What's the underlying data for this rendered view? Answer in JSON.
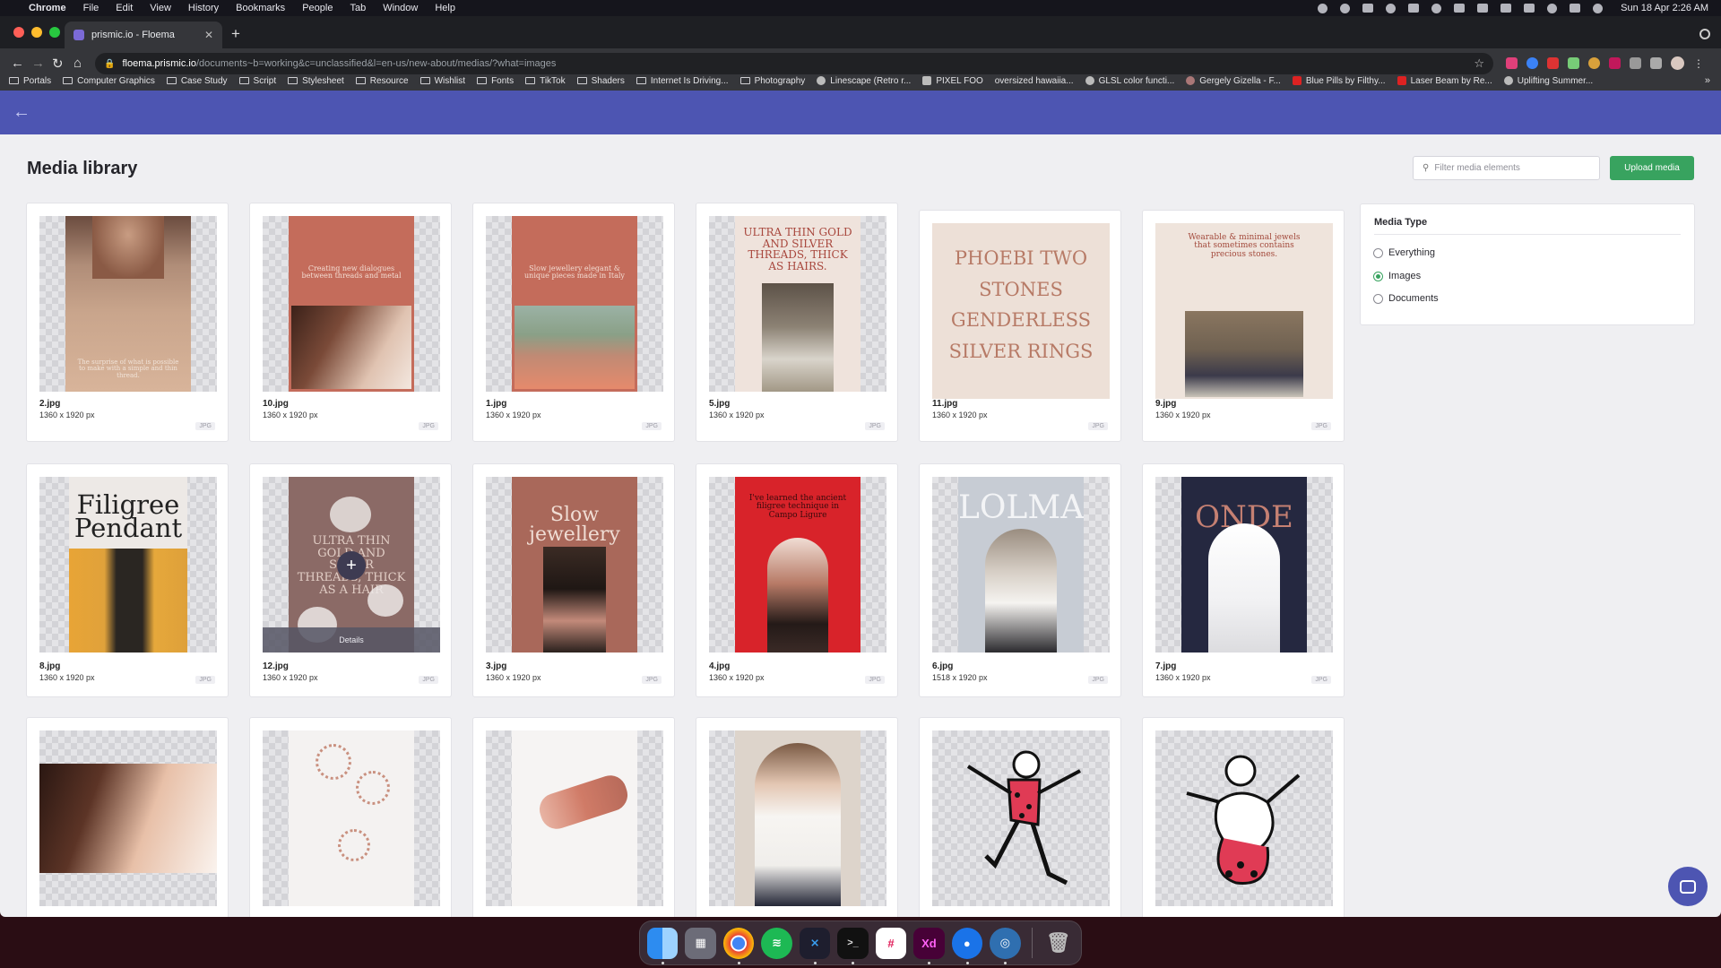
{
  "menubar": {
    "app": "Chrome",
    "items": [
      "File",
      "Edit",
      "View",
      "History",
      "Bookmarks",
      "People",
      "Tab",
      "Window",
      "Help"
    ],
    "clock": "Sun 18 Apr  2:26 AM"
  },
  "browser": {
    "tab_title": "prismic.io - Floema",
    "url_host": "floema.prismic.io",
    "url_path": "/documents~b=working&c=unclassified&l=en-us/new-about/medias/?what=images",
    "bookmarks": [
      "Portals",
      "Computer Graphics",
      "Case Study",
      "Script",
      "Stylesheet",
      "Resource",
      "Wishlist",
      "Fonts",
      "TikTok",
      "Shaders",
      "Internet Is Driving...",
      "Photography",
      "Linescape (Retro r...",
      "PIXEL FOO",
      "oversized hawaiia...",
      "GLSL color functi...",
      "Gergely Gizella - F...",
      "Blue Pills by Filthy...",
      "Laser Beam by Re...",
      "Uplifting Summer..."
    ]
  },
  "page": {
    "title": "Media library",
    "filter_placeholder": "Filter media elements",
    "upload_label": "Upload media"
  },
  "media_type": {
    "title": "Media Type",
    "options": [
      "Everything",
      "Images",
      "Documents"
    ],
    "selected": "Images"
  },
  "media": [
    {
      "name": "2.jpg",
      "size": "1360 x 1920 px",
      "type": "JPG",
      "poster_text": "The surprise of what is possible to make with a simple and thin thread."
    },
    {
      "name": "10.jpg",
      "size": "1360 x 1920 px",
      "type": "JPG",
      "poster_text": "Creating new dialogues between threads and metal"
    },
    {
      "name": "1.jpg",
      "size": "1360 x 1920 px",
      "type": "JPG",
      "poster_text": "Slow jewellery elegant & unique pieces made in Italy"
    },
    {
      "name": "5.jpg",
      "size": "1360 x 1920 px",
      "type": "JPG",
      "poster_text": "ULTRA THIN GOLD AND SILVER THREADS, THICK AS HAIRS."
    },
    {
      "name": "11.jpg",
      "size": "1360 x 1920 px",
      "type": "JPG",
      "poster_text": "PHOEBI TWO STONES GENDERLESS SILVER RINGS"
    },
    {
      "name": "9.jpg",
      "size": "1360 x 1920 px",
      "type": "JPG",
      "poster_text": "Wearable & minimal jewels that sometimes contains precious stones."
    },
    {
      "name": "8.jpg",
      "size": "1360 x 1920 px",
      "type": "JPG",
      "poster_text": "Filigree Pendant"
    },
    {
      "name": "12.jpg",
      "size": "1360 x 1920 px",
      "type": "JPG",
      "poster_text": "ULTRA THIN GOLD AND SILVER THREADS, THICK AS A HAIR",
      "overlay_details": "Details"
    },
    {
      "name": "3.jpg",
      "size": "1360 x 1920 px",
      "type": "JPG",
      "poster_text": "Slow jewellery"
    },
    {
      "name": "4.jpg",
      "size": "1360 x 1920 px",
      "type": "JPG",
      "poster_text": "I've learned the ancient filigree technique in Campo Ligure"
    },
    {
      "name": "6.jpg",
      "size": "1518 x 1920 px",
      "type": "JPG",
      "poster_text": "LOLMA"
    },
    {
      "name": "7.jpg",
      "size": "1360 x 1920 px",
      "type": "JPG",
      "poster_text": "ONDE"
    }
  ],
  "dock": [
    "Finder",
    "Launchpad",
    "Chrome",
    "Spotify",
    "VS Code",
    "Terminal",
    "Slack",
    "Adobe XD",
    "Maps",
    "Safari",
    "Trash"
  ],
  "colors": {
    "appbar": "#4d55b2",
    "accent_green": "#38a35f",
    "terracotta": "#c46c5b",
    "red_poster": "#d8232a",
    "navy_poster": "#252840"
  }
}
